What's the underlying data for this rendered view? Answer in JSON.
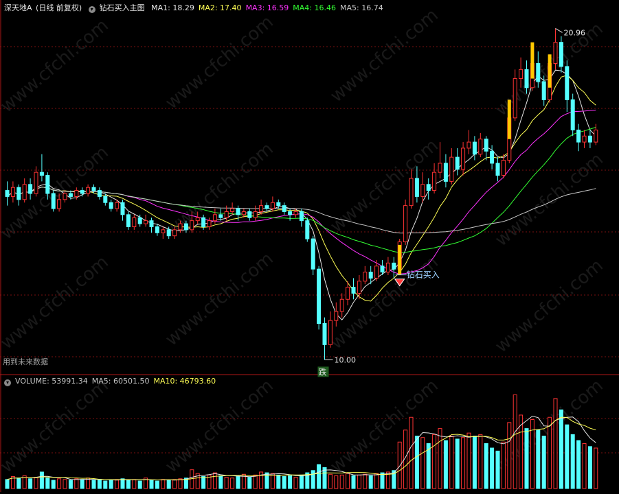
{
  "main_header": {
    "stock": "深天地A",
    "period": "(日线 前复权)",
    "indicator": "钻石买入主图",
    "ma": [
      {
        "label": "MA1",
        "value": "18.29",
        "color": "#e6e6e6"
      },
      {
        "label": "MA2",
        "value": "17.40",
        "color": "#ffff55"
      },
      {
        "label": "MA3",
        "value": "16.59",
        "color": "#ff33ff"
      },
      {
        "label": "MA4",
        "value": "16.46",
        "color": "#33ff33"
      },
      {
        "label": "MA5",
        "value": "16.74",
        "color": "#c8c8c8"
      }
    ]
  },
  "volume_header": {
    "items": [
      {
        "label": "VOLUME",
        "value": "53991.34",
        "color": "#c8c8c8"
      },
      {
        "label": "MA5",
        "value": "60501.50",
        "color": "#c8c8c8"
      },
      {
        "label": "MA10",
        "value": "46793.60",
        "color": "#ffff55"
      }
    ]
  },
  "annotations": {
    "high_label": "20.96",
    "low_label": "10.00",
    "buy_signal": "钻石买入",
    "drop_badge": "跌",
    "future_note": "用到未来数据"
  },
  "watermark": "www.cfchi.com",
  "colors": {
    "background": "#000000",
    "up": "#ff3333",
    "down": "#55ffff",
    "grid": "#7a1010",
    "separator": "#b01818",
    "signal_bar": "#ffc800",
    "volume_ma10": "#ffff55"
  },
  "chart_data": [
    {
      "type": "candlestick",
      "title": "深天地A (日线 前复权)",
      "candles": [
        [
          15.6,
          15.4,
          15.9,
          15.1
        ],
        [
          15.4,
          15.7,
          15.9,
          15.2
        ],
        [
          15.7,
          15.3,
          15.8,
          15.1
        ],
        [
          15.3,
          15.8,
          16.0,
          15.2
        ],
        [
          15.8,
          15.5,
          16.0,
          15.3
        ],
        [
          15.5,
          16.2,
          16.4,
          15.4
        ],
        [
          16.2,
          16.1,
          16.8,
          15.9
        ],
        [
          16.1,
          15.5,
          16.2,
          15.3
        ],
        [
          15.5,
          15.0,
          15.6,
          14.9
        ],
        [
          15.0,
          15.3,
          15.5,
          14.9
        ],
        [
          15.3,
          15.5,
          15.6,
          15.2
        ],
        [
          15.5,
          15.4,
          15.6,
          15.3
        ],
        [
          15.4,
          15.6,
          15.7,
          15.3
        ],
        [
          15.6,
          15.5,
          15.7,
          15.4
        ],
        [
          15.5,
          15.7,
          15.8,
          15.4
        ],
        [
          15.7,
          15.6,
          15.8,
          15.5
        ],
        [
          15.6,
          15.4,
          15.7,
          15.3
        ],
        [
          15.4,
          15.2,
          15.5,
          15.1
        ],
        [
          15.2,
          15.0,
          15.3,
          14.9
        ],
        [
          15.0,
          15.2,
          15.3,
          14.9
        ],
        [
          15.2,
          14.8,
          15.3,
          14.6
        ],
        [
          14.8,
          14.4,
          14.9,
          14.3
        ],
        [
          14.4,
          14.7,
          14.8,
          14.3
        ],
        [
          14.7,
          14.5,
          14.8,
          14.4
        ],
        [
          14.5,
          14.6,
          14.8,
          14.4
        ],
        [
          14.6,
          14.4,
          14.7,
          14.2
        ],
        [
          14.4,
          14.2,
          14.5,
          14.1
        ],
        [
          14.2,
          14.3,
          14.4,
          14.0
        ],
        [
          14.3,
          14.1,
          14.4,
          14.0
        ],
        [
          14.1,
          14.3,
          14.4,
          14.0
        ],
        [
          14.3,
          14.5,
          14.6,
          14.2
        ],
        [
          14.5,
          14.3,
          14.6,
          14.2
        ],
        [
          14.3,
          14.6,
          14.9,
          14.2
        ],
        [
          14.6,
          14.7,
          14.9,
          14.5
        ],
        [
          14.7,
          14.4,
          14.8,
          14.3
        ],
        [
          14.4,
          14.6,
          14.7,
          14.3
        ],
        [
          14.6,
          14.8,
          15.0,
          14.5
        ],
        [
          14.8,
          14.7,
          15.0,
          14.6
        ],
        [
          14.7,
          14.9,
          15.1,
          14.6
        ],
        [
          14.9,
          15.0,
          15.2,
          14.8
        ],
        [
          15.0,
          14.8,
          15.1,
          14.6
        ],
        [
          14.8,
          14.9,
          15.0,
          14.7
        ],
        [
          14.9,
          14.7,
          15.0,
          14.6
        ],
        [
          14.7,
          14.9,
          15.1,
          14.6
        ],
        [
          14.9,
          15.1,
          15.3,
          14.8
        ],
        [
          15.1,
          15.0,
          15.2,
          14.9
        ],
        [
          15.0,
          15.2,
          15.4,
          14.9
        ],
        [
          15.2,
          15.1,
          15.3,
          15.0
        ],
        [
          15.1,
          14.9,
          15.2,
          14.8
        ],
        [
          14.9,
          14.8,
          15.0,
          14.6
        ],
        [
          14.8,
          14.9,
          15.0,
          14.7
        ],
        [
          14.9,
          14.6,
          15.0,
          14.4
        ],
        [
          14.6,
          14.0,
          14.7,
          13.9
        ],
        [
          14.0,
          13.0,
          14.1,
          12.8
        ],
        [
          13.0,
          11.2,
          13.1,
          11.0
        ],
        [
          11.2,
          10.5,
          11.4,
          10.0
        ],
        [
          10.5,
          11.3,
          11.6,
          10.4
        ],
        [
          11.3,
          11.6,
          11.9,
          11.1
        ],
        [
          11.6,
          12.0,
          12.2,
          11.4
        ],
        [
          12.0,
          12.4,
          12.6,
          11.8
        ],
        [
          12.4,
          12.2,
          12.7,
          12.0
        ],
        [
          12.2,
          12.6,
          12.8,
          12.0
        ],
        [
          12.6,
          12.9,
          13.1,
          12.5
        ],
        [
          12.9,
          12.7,
          13.1,
          12.5
        ],
        [
          12.7,
          13.1,
          13.3,
          12.6
        ],
        [
          13.1,
          12.9,
          13.3,
          12.8
        ],
        [
          12.9,
          13.2,
          13.4,
          12.8
        ],
        [
          13.2,
          13.0,
          13.4,
          12.7
        ],
        [
          13.0,
          13.9,
          14.0,
          12.9
        ],
        [
          13.9,
          15.1,
          15.3,
          13.8
        ],
        [
          15.1,
          16.0,
          16.3,
          15.0
        ],
        [
          16.0,
          15.4,
          16.4,
          15.2
        ],
        [
          15.4,
          15.8,
          16.2,
          15.2
        ],
        [
          15.8,
          15.6,
          16.0,
          15.3
        ],
        [
          15.6,
          16.2,
          16.5,
          15.5
        ],
        [
          16.2,
          16.5,
          17.2,
          16.0
        ],
        [
          16.5,
          15.9,
          16.8,
          15.7
        ],
        [
          15.9,
          16.7,
          17.0,
          15.8
        ],
        [
          16.7,
          16.3,
          17.0,
          16.1
        ],
        [
          16.3,
          17.0,
          17.2,
          16.1
        ],
        [
          17.0,
          17.2,
          17.6,
          16.8
        ],
        [
          17.2,
          16.8,
          17.4,
          16.6
        ],
        [
          16.8,
          17.3,
          17.5,
          16.7
        ],
        [
          17.3,
          16.9,
          17.4,
          16.6
        ],
        [
          16.9,
          16.5,
          17.1,
          16.3
        ],
        [
          16.5,
          16.1,
          16.7,
          15.9
        ],
        [
          16.1,
          16.6,
          16.8,
          16.0
        ],
        [
          16.6,
          18.0,
          18.3,
          16.5
        ],
        [
          18.0,
          19.3,
          19.6,
          17.9
        ],
        [
          19.3,
          19.6,
          20.0,
          19.0
        ],
        [
          19.6,
          19.0,
          19.9,
          18.8
        ],
        [
          19.0,
          19.8,
          20.1,
          18.9
        ],
        [
          19.8,
          19.2,
          20.2,
          19.0
        ],
        [
          19.2,
          18.6,
          19.4,
          18.4
        ],
        [
          18.6,
          19.8,
          20.1,
          18.5
        ],
        [
          19.8,
          20.5,
          20.96,
          19.6
        ],
        [
          20.5,
          19.7,
          20.7,
          19.5
        ],
        [
          19.7,
          18.6,
          19.9,
          18.2
        ],
        [
          18.6,
          17.6,
          18.8,
          17.4
        ],
        [
          17.6,
          17.2,
          17.8,
          16.9
        ],
        [
          17.2,
          17.4,
          17.6,
          17.0
        ],
        [
          17.4,
          17.2,
          17.6,
          17.0
        ],
        [
          17.2,
          17.6,
          17.8,
          17.1
        ]
      ],
      "signal_bars": [
        {
          "index": 68,
          "range": [
            12.8,
            13.8
          ]
        },
        {
          "index": 87,
          "range": [
            17.3,
            18.6
          ]
        },
        {
          "index": 91,
          "range": [
            19.3,
            20.5
          ]
        },
        {
          "index": 94,
          "range": [
            19.0,
            20.1
          ]
        }
      ],
      "buy_signal_index": 68,
      "high": 20.96,
      "low": 10.0
    },
    {
      "type": "bar",
      "title": "VOLUME",
      "values": [
        12000,
        16000,
        14000,
        17000,
        13000,
        15000,
        22000,
        14000,
        11000,
        13000,
        12000,
        11000,
        13000,
        12000,
        14000,
        11000,
        12000,
        10000,
        11000,
        12000,
        13000,
        11000,
        12000,
        10000,
        14000,
        11000,
        10000,
        12000,
        11000,
        12000,
        13000,
        14000,
        25000,
        20000,
        16000,
        18000,
        21000,
        17000,
        15000,
        14000,
        16000,
        19000,
        15000,
        18000,
        22000,
        21000,
        20000,
        18000,
        16000,
        17000,
        15000,
        18000,
        21000,
        24000,
        32000,
        28000,
        19000,
        17000,
        18000,
        20000,
        17000,
        18000,
        19000,
        17000,
        20000,
        21000,
        22000,
        24000,
        62000,
        78000,
        95000,
        70000,
        68000,
        60000,
        72000,
        80000,
        64000,
        70000,
        66000,
        68000,
        74000,
        70000,
        72000,
        60000,
        54000,
        50000,
        62000,
        88000,
        125000,
        98000,
        80000,
        92000,
        78000,
        70000,
        95000,
        120000,
        105000,
        85000,
        72000,
        64000,
        60000,
        56000,
        54000
      ],
      "series": [
        {
          "name": "MA5",
          "value": 60501.5
        },
        {
          "name": "MA10",
          "value": 46793.6
        }
      ]
    }
  ]
}
